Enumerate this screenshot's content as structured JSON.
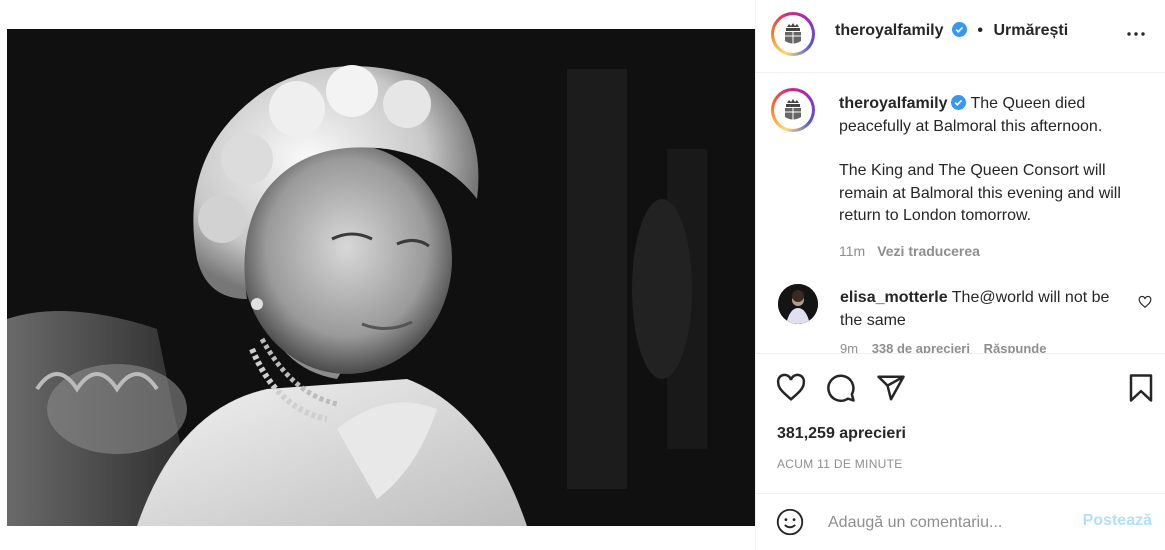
{
  "header": {
    "username": "theroyalfamily",
    "separator": "•",
    "follow_label": "Urmărești",
    "more_icon": "more-horizontal-icon"
  },
  "caption": {
    "username": "theroyalfamily",
    "text_line1": "The Queen died peacefully at Balmoral this afternoon.",
    "text_line2": "The King and The Queen Consort will remain at Balmoral this evening and will return to London tomorrow.",
    "time": "11m",
    "translate_label": "Vezi traducerea"
  },
  "comments": [
    {
      "username": "elisa_motterle",
      "text": "The@world will not be the same",
      "time": "9m",
      "likes": "338 de aprecieri",
      "reply_label": "Răspunde"
    }
  ],
  "actions": {
    "like_icon": "heart-icon",
    "comment_icon": "comment-icon",
    "share_icon": "send-icon",
    "save_icon": "bookmark-icon"
  },
  "likes_label": "381,259 aprecieri",
  "timestamp": "ACUM 11 DE MINUTE",
  "add_comment": {
    "placeholder": "Adaugă un comentariu...",
    "post_label": "Postează"
  },
  "colors": {
    "verified": "#3897f0",
    "post_disabled": "#b2dffc",
    "secondary_text": "#8e8e8e"
  }
}
